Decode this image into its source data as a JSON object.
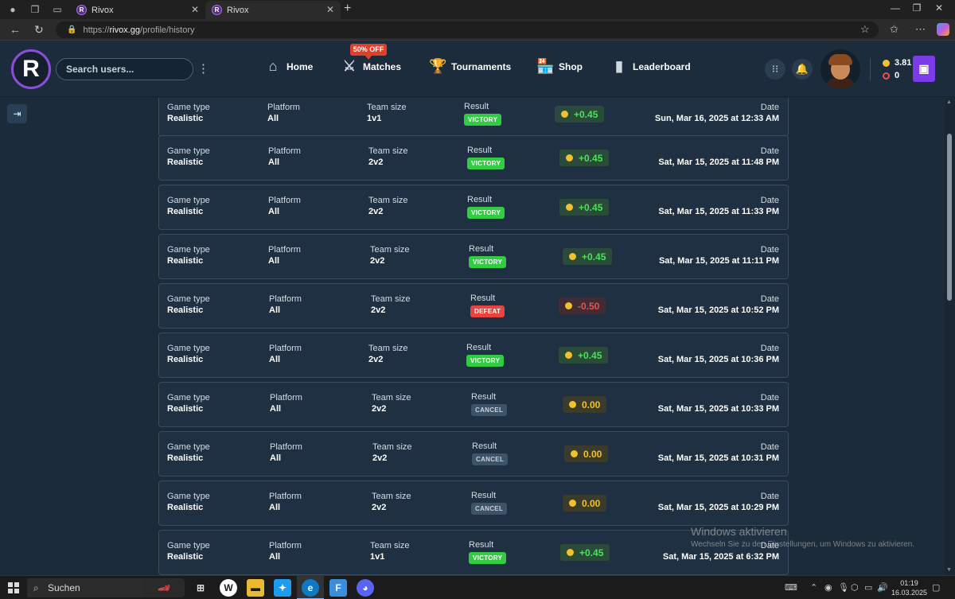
{
  "browser": {
    "tabs": [
      {
        "title": "Rivox",
        "active": false
      },
      {
        "title": "Rivox",
        "active": true
      }
    ],
    "url": {
      "scheme": "https://",
      "host": "rivox.gg",
      "path": "/profile/history"
    }
  },
  "header": {
    "logo_letter": "R",
    "search_placeholder": "Search users...",
    "nav": [
      {
        "label": "Home",
        "icon": "home-icon"
      },
      {
        "label": "Matches",
        "icon": "crossed-swords-icon"
      },
      {
        "label": "Tournaments",
        "icon": "trophy-icon"
      },
      {
        "label": "Shop",
        "icon": "store-icon"
      },
      {
        "label": "Leaderboard",
        "icon": "bar-chart-icon"
      }
    ],
    "offer_badge": "50% OFF",
    "balance_coins": "3.81",
    "balance_tokens": "0"
  },
  "matches": [
    {
      "game_type_label": "Game type",
      "game_type": "Realistic",
      "platform_label": "Platform",
      "platform": "All",
      "team_size_label": "Team size",
      "team_size": "1v1",
      "result_label": "Result",
      "result": "VICTORY",
      "amount": "+0.45",
      "date_label": "Date",
      "date": "Sun, Mar 16, 2025 at 12:33 AM"
    },
    {
      "game_type_label": "Game type",
      "game_type": "Realistic",
      "platform_label": "Platform",
      "platform": "All",
      "team_size_label": "Team size",
      "team_size": "2v2",
      "result_label": "Result",
      "result": "VICTORY",
      "amount": "+0.45",
      "date_label": "Date",
      "date": "Sat, Mar 15, 2025 at 11:48 PM"
    },
    {
      "game_type_label": "Game type",
      "game_type": "Realistic",
      "platform_label": "Platform",
      "platform": "All",
      "team_size_label": "Team size",
      "team_size": "2v2",
      "result_label": "Result",
      "result": "VICTORY",
      "amount": "+0.45",
      "date_label": "Date",
      "date": "Sat, Mar 15, 2025 at 11:33 PM"
    },
    {
      "game_type_label": "Game type",
      "game_type": "Realistic",
      "platform_label": "Platform",
      "platform": "All",
      "team_size_label": "Team size",
      "team_size": "2v2",
      "result_label": "Result",
      "result": "VICTORY",
      "amount": "+0.45",
      "date_label": "Date",
      "date": "Sat, Mar 15, 2025 at 11:11 PM"
    },
    {
      "game_type_label": "Game type",
      "game_type": "Realistic",
      "platform_label": "Platform",
      "platform": "All",
      "team_size_label": "Team size",
      "team_size": "2v2",
      "result_label": "Result",
      "result": "DEFEAT",
      "amount": "-0.50",
      "date_label": "Date",
      "date": "Sat, Mar 15, 2025 at 10:52 PM"
    },
    {
      "game_type_label": "Game type",
      "game_type": "Realistic",
      "platform_label": "Platform",
      "platform": "All",
      "team_size_label": "Team size",
      "team_size": "2v2",
      "result_label": "Result",
      "result": "VICTORY",
      "amount": "+0.45",
      "date_label": "Date",
      "date": "Sat, Mar 15, 2025 at 10:36 PM"
    },
    {
      "game_type_label": "Game type",
      "game_type": "Realistic",
      "platform_label": "Platform",
      "platform": "All",
      "team_size_label": "Team size",
      "team_size": "2v2",
      "result_label": "Result",
      "result": "CANCEL",
      "amount": "0.00",
      "date_label": "Date",
      "date": "Sat, Mar 15, 2025 at 10:33 PM"
    },
    {
      "game_type_label": "Game type",
      "game_type": "Realistic",
      "platform_label": "Platform",
      "platform": "All",
      "team_size_label": "Team size",
      "team_size": "2v2",
      "result_label": "Result",
      "result": "CANCEL",
      "amount": "0.00",
      "date_label": "Date",
      "date": "Sat, Mar 15, 2025 at 10:31 PM"
    },
    {
      "game_type_label": "Game type",
      "game_type": "Realistic",
      "platform_label": "Platform",
      "platform": "All",
      "team_size_label": "Team size",
      "team_size": "2v2",
      "result_label": "Result",
      "result": "CANCEL",
      "amount": "0.00",
      "date_label": "Date",
      "date": "Sat, Mar 15, 2025 at 10:29 PM"
    },
    {
      "game_type_label": "Game type",
      "game_type": "Realistic",
      "platform_label": "Platform",
      "platform": "All",
      "team_size_label": "Team size",
      "team_size": "1v1",
      "result_label": "Result",
      "result": "VICTORY",
      "amount": "+0.45",
      "date_label": "Date",
      "date": "Sat, Mar 15, 2025 at 6:32 PM"
    }
  ],
  "colors": {
    "victory": "#31cc42",
    "defeat": "#e8433e",
    "cancel": "#3d5368",
    "coin": "#f2c12e",
    "accent": "#7b3be6"
  },
  "watermark": {
    "title": "Windows aktivieren",
    "subtitle": "Wechseln Sie zu den Einstellungen, um Windows zu aktivieren."
  },
  "taskbar": {
    "search_label": "Suchen",
    "time": "01:19",
    "date": "16.03.2025"
  }
}
